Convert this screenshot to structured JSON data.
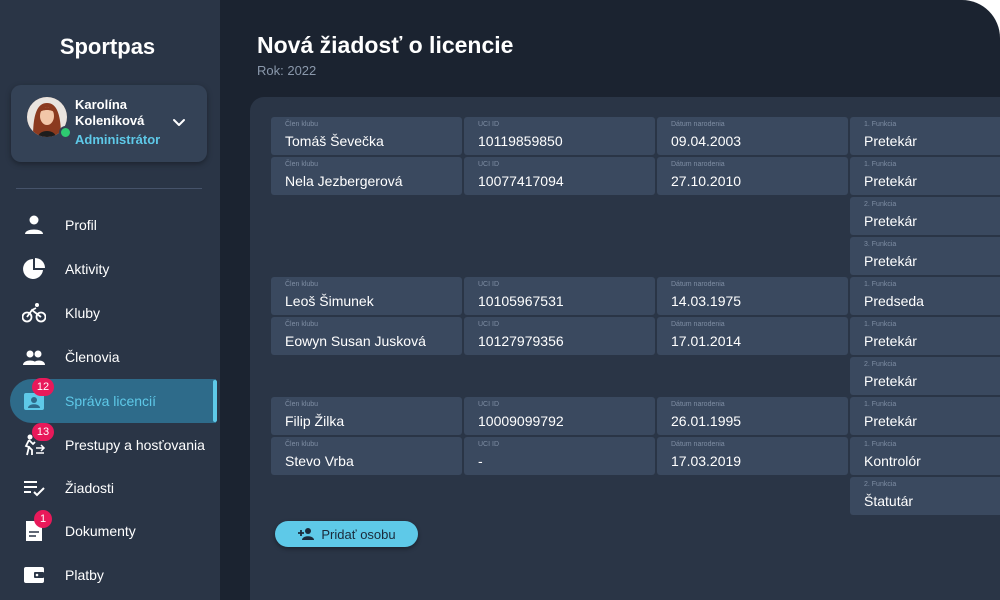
{
  "app": {
    "name": "Sportpas"
  },
  "user": {
    "first_name": "Karolína",
    "last_name": "Koleníková",
    "role": "Administrátor"
  },
  "nav": [
    {
      "id": "profil",
      "label": "Profil",
      "icon": "person-icon"
    },
    {
      "id": "aktivity",
      "label": "Aktivity",
      "icon": "pie-chart-icon"
    },
    {
      "id": "kluby",
      "label": "Kluby",
      "icon": "bicycle-icon"
    },
    {
      "id": "clenovia",
      "label": "Členovia",
      "icon": "group-icon"
    },
    {
      "id": "sprava-licencii",
      "label": "Správa licencií",
      "icon": "badge-icon",
      "badge": "12",
      "active": true
    },
    {
      "id": "prestupy",
      "label": "Prestupy a hosťovania",
      "icon": "transfer-icon",
      "badge": "13"
    },
    {
      "id": "ziadosti",
      "label": "Žiadosti",
      "icon": "checklist-icon"
    },
    {
      "id": "dokumenty",
      "label": "Dokumenty",
      "icon": "document-icon",
      "badge": "1"
    },
    {
      "id": "platby",
      "label": "Platby",
      "icon": "wallet-icon"
    }
  ],
  "page": {
    "title": "Nová žiadosť o licencie",
    "subtitle": "Rok: 2022"
  },
  "labels": {
    "member": "Člen klubu",
    "uci": "UCI ID",
    "birth": "Dátum narodenia",
    "function_1": "1. Funkcia",
    "function_2": "2. Funkcia",
    "function_3": "3. Funkcia"
  },
  "members": [
    {
      "name": "Tomáš Ševečka",
      "uci": "10119859850",
      "birth": "09.04.2003",
      "functions": [
        "Pretekár"
      ]
    },
    {
      "name": "Nela Jezbergerová",
      "uci": "10077417094",
      "birth": "27.10.2010",
      "functions": [
        "Pretekár",
        "Pretekár",
        "Pretekár"
      ]
    },
    {
      "name": "Leoš Šimunek",
      "uci": "10105967531",
      "birth": "14.03.1975",
      "functions": [
        "Predseda"
      ]
    },
    {
      "name": "Eowyn Susan Jusková",
      "uci": "10127979356",
      "birth": "17.01.2014",
      "functions": [
        "Pretekár",
        "Pretekár"
      ]
    },
    {
      "name": "Filip Žilka",
      "uci": "10009099792",
      "birth": "26.01.1995",
      "functions": [
        "Pretekár"
      ]
    },
    {
      "name": "Stevo Vrba",
      "uci": "-",
      "birth": "17.03.2019",
      "functions": [
        "Kontrolór",
        "Štatutár"
      ]
    }
  ],
  "actions": {
    "add_person": "Pridať osobu"
  },
  "colors": {
    "accent": "#5ec9e8",
    "badge": "#e8195a",
    "background": "#1b2330",
    "sidebar": "#2a3546",
    "cell": "#3a495f"
  }
}
